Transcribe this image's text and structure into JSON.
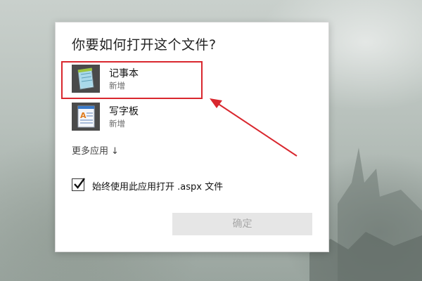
{
  "dialog": {
    "title": "你要如何打开这个文件?",
    "apps": [
      {
        "name": "记事本",
        "sub": "新增",
        "icon": "notepad-icon"
      },
      {
        "name": "写字板",
        "sub": "新增",
        "icon": "wordpad-icon"
      }
    ],
    "more_apps_label": "更多应用",
    "more_apps_arrow": "↓",
    "always_use_label": "始终使用此应用打开 .aspx 文件",
    "always_use_checked": true,
    "ok_label": "确定"
  },
  "colors": {
    "highlight": "#d9272e",
    "button_bg": "#e6e6e6",
    "button_text": "#a8a8a8"
  }
}
